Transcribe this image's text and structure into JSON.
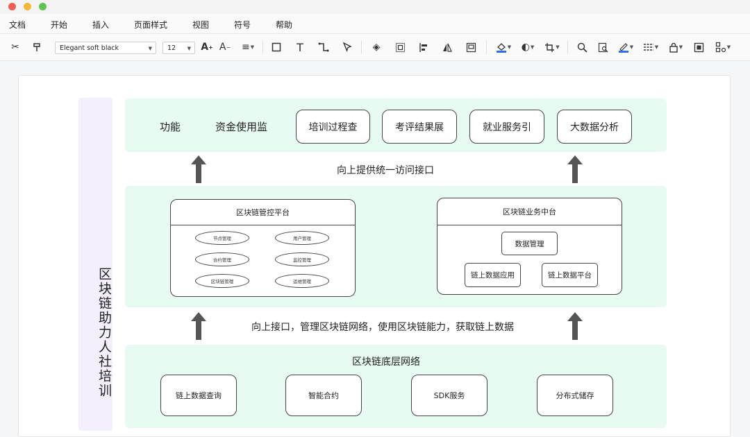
{
  "window": {
    "lights": [
      "#ee5e57",
      "#f3b83b",
      "#5fc453"
    ]
  },
  "menu": [
    "文档",
    "开始",
    "插入",
    "页面样式",
    "视图",
    "符号",
    "帮助"
  ],
  "toolbar": {
    "font_family": "Elegant soft black",
    "font_size": "12"
  },
  "diagram": {
    "side_title": "区块链助力人社培训",
    "top": {
      "label_1": "功能",
      "label_2": "资金使用监",
      "boxes": [
        "培训过程查",
        "考评结果展",
        "就业服务引",
        "大数据分析"
      ]
    },
    "caption_1": "向上提供统一访问接口",
    "middle": {
      "left_panel": {
        "title": "区块链管控平台",
        "ovals": [
          "节点管理",
          "用户管理",
          "合约管理",
          "监控管理",
          "区块链管理",
          "运维管理"
        ]
      },
      "right_panel": {
        "title": "区块链业务中台",
        "items": [
          "数据管理",
          "链上数据应用",
          "链上数据平台"
        ]
      }
    },
    "caption_2": "向上接口，管理区块链网络，使用区块链能力，获取链上数据",
    "bottom": {
      "title": "区块链底层网络",
      "boxes": [
        "链上数据查询",
        "智能合约",
        "SDK服务",
        "分布式储存"
      ]
    },
    "colors": {
      "band": "#e8fbf2",
      "side": "#f3effd",
      "arrow": "#555555"
    }
  }
}
